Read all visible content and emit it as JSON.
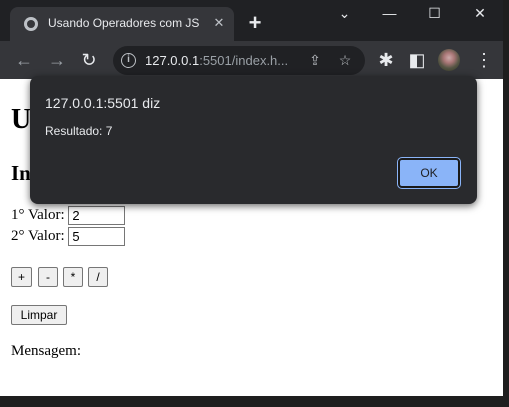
{
  "window": {
    "tab_title": "Usando Operadores com JS",
    "tab_close": "✕",
    "new_tab": "+",
    "controls": {
      "menu": "⌄",
      "minimize": "—",
      "maximize": "☐",
      "close": "✕"
    }
  },
  "toolbar": {
    "back": "←",
    "forward": "→",
    "reload": "↻",
    "url_host": "127.0.0.1",
    "url_rest": ":5501/index.h..."
  },
  "page": {
    "heading1": "U",
    "heading2": "In",
    "field1": {
      "label": "1° Valor:",
      "value": "2"
    },
    "field2": {
      "label": "2° Valor:",
      "value": "5"
    },
    "op_buttons": [
      "+",
      "-",
      "*",
      "/"
    ],
    "clear_button": "Limpar",
    "message_label": "Mensagem:"
  },
  "dialog": {
    "title": "127.0.0.1:5501 diz",
    "message": "Resultado: 7",
    "ok_label": "OK"
  },
  "colors": {
    "accent": "#8ab4f8",
    "chrome_dark": "#202124",
    "toolbar": "#35363a"
  }
}
